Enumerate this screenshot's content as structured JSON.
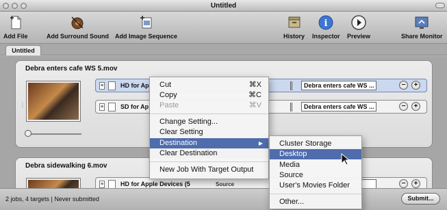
{
  "window": {
    "title": "Untitled"
  },
  "toolbar": {
    "add_file": "Add File",
    "add_surround_sound": "Add Surround Sound",
    "add_image_sequence": "Add Image Sequence",
    "history": "History",
    "inspector": "Inspector",
    "preview": "Preview",
    "share_monitor": "Share Monitor"
  },
  "tabs": [
    {
      "label": "Untitled"
    }
  ],
  "jobs": [
    {
      "title": "Debra enters cafe WS 5.mov",
      "targets": [
        {
          "name": "HD for Ap",
          "destination": "Debra enters cafe WS ..."
        },
        {
          "name": "SD for Ap",
          "destination": "Debra enters cafe WS ..."
        }
      ]
    },
    {
      "title": "Debra sidewalking 6.mov",
      "targets": [
        {
          "name": "HD for Apple Devices (5",
          "source": "Source",
          "destination": "6-"
        }
      ]
    }
  ],
  "context_menu": {
    "cut": "Cut",
    "cut_shortcut": "⌘X",
    "copy": "Copy",
    "copy_shortcut": "⌘C",
    "paste": "Paste",
    "paste_shortcut": "⌘V",
    "change_setting": "Change Setting...",
    "clear_setting": "Clear Setting",
    "destination": "Destination",
    "clear_destination": "Clear Destination",
    "new_job": "New Job With Target Output"
  },
  "submenu": {
    "cluster_storage": "Cluster Storage",
    "desktop": "Desktop",
    "media": "Media",
    "source": "Source",
    "users_movies": "User's Movies Folder",
    "other": "Other..."
  },
  "status": {
    "text": "2 jobs, 4 targets  |  Never submitted",
    "submit_label": "Submit..."
  },
  "colors": {
    "highlight": "#4f6cac",
    "selected_row": "#cbd8ee"
  }
}
